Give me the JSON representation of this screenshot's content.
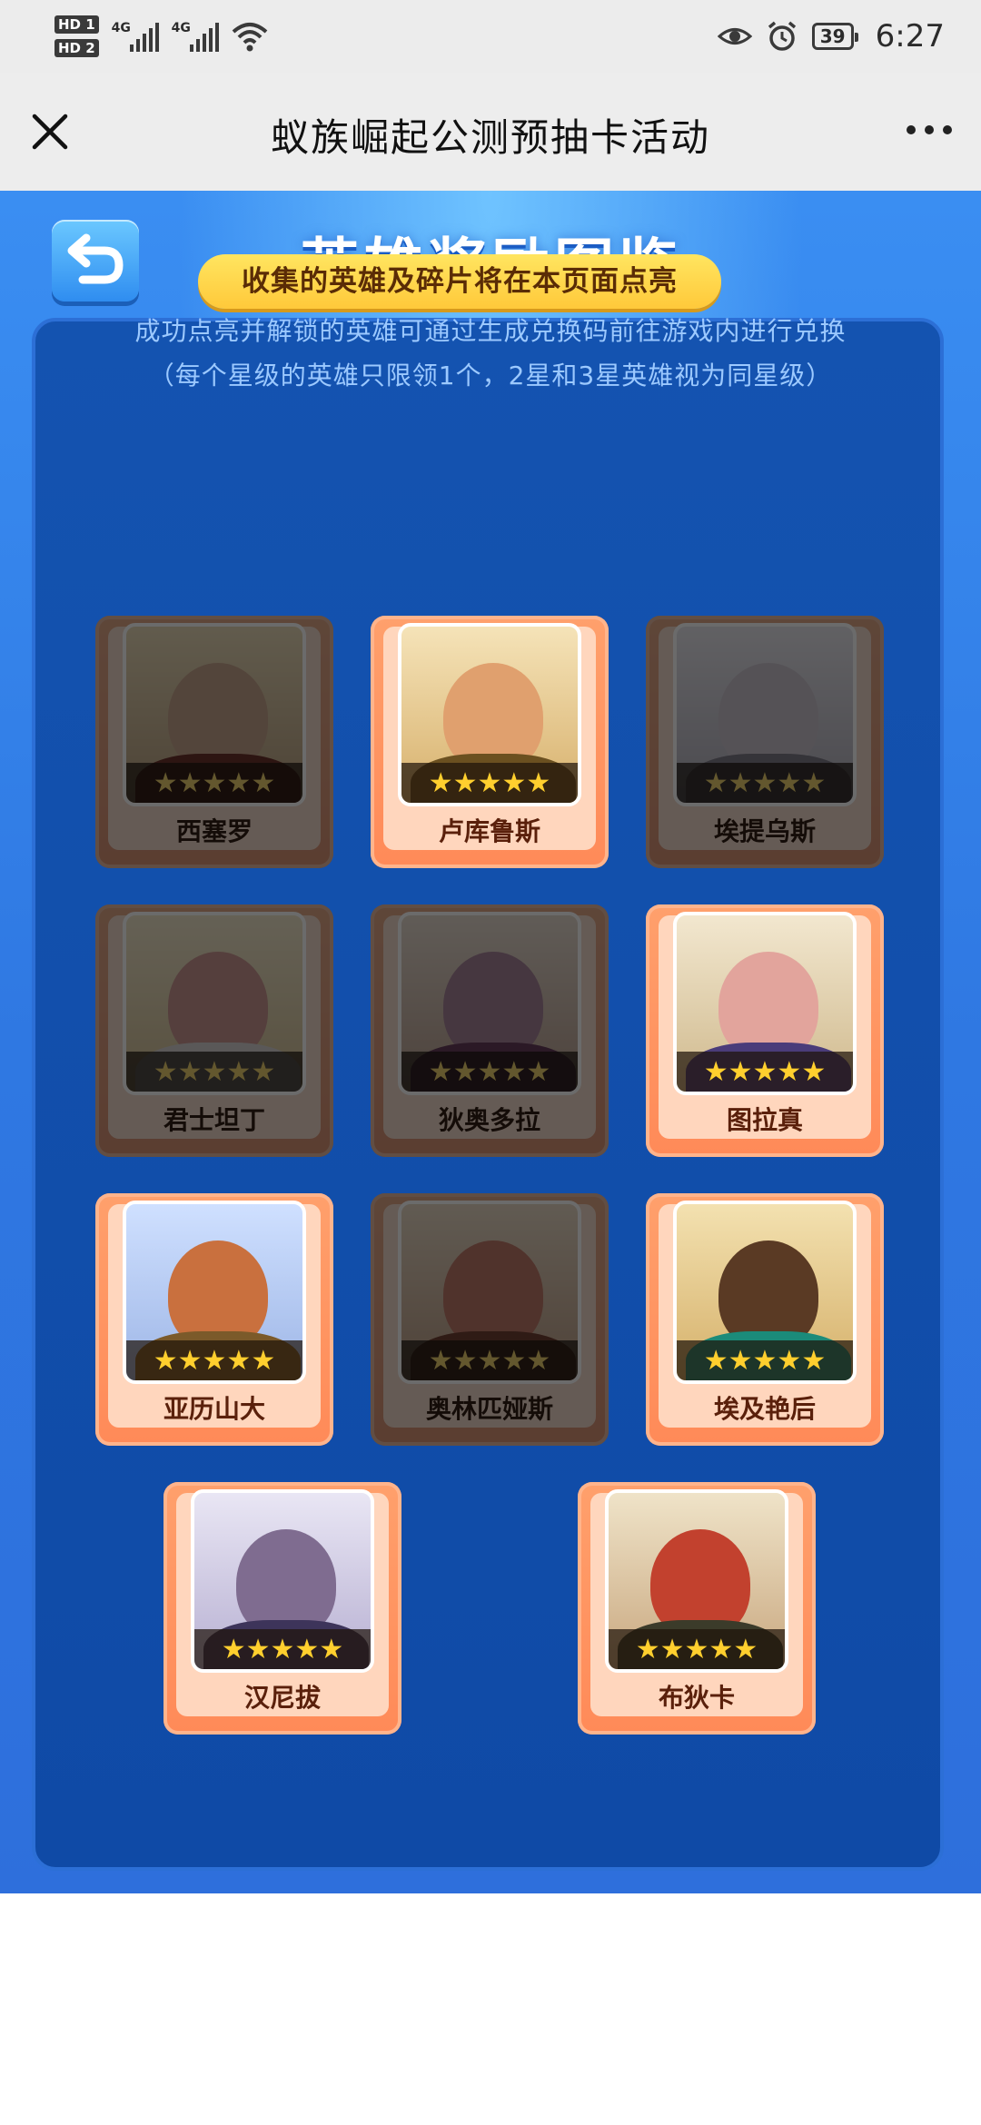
{
  "status_bar": {
    "hd1": "HD 1",
    "hd2": "HD 2",
    "net1": "4G",
    "net2": "4G",
    "battery": "39",
    "time": "6:27"
  },
  "title_bar": {
    "title": "蚁族崛起公测预抽卡活动"
  },
  "page": {
    "title": "英雄奖励图鉴",
    "notice": "收集的英雄及碎片将在本页面点亮",
    "description": "成功点亮并解锁的英雄可通过生成兑换码前往游戏内进行兑换（每个星级的英雄只限领1个，2星和3星英雄视为同星级）"
  },
  "heroes": [
    {
      "name": "西塞罗",
      "stars": "★★★★★",
      "unlocked": false
    },
    {
      "name": "卢库鲁斯",
      "stars": "★★★★★",
      "unlocked": true
    },
    {
      "name": "埃提乌斯",
      "stars": "★★★★★",
      "unlocked": false
    },
    {
      "name": "君士坦丁",
      "stars": "★★★★★",
      "unlocked": false
    },
    {
      "name": "狄奥多拉",
      "stars": "★★★★★",
      "unlocked": false
    },
    {
      "name": "图拉真",
      "stars": "★★★★★",
      "unlocked": true
    },
    {
      "name": "亚历山大",
      "stars": "★★★★★",
      "unlocked": true
    },
    {
      "name": "奥林匹娅斯",
      "stars": "★★★★★",
      "unlocked": false
    },
    {
      "name": "埃及艳后",
      "stars": "★★★★★",
      "unlocked": true
    },
    {
      "name": "汉尼拔",
      "stars": "★★★★★",
      "unlocked": true
    },
    {
      "name": "布狄卡",
      "stars": "★★★★★",
      "unlocked": true
    }
  ],
  "colors": {
    "accent_yellow": "#ffd23f",
    "panel_blue": "#1453b0",
    "card_orange": "#ff9160"
  }
}
